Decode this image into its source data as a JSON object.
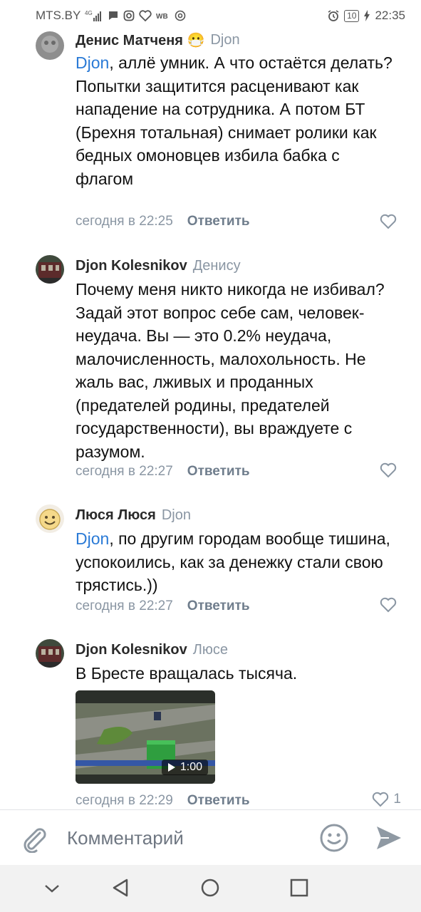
{
  "status_bar": {
    "carrier": "MTS.BY",
    "network": "4G",
    "battery": "10",
    "time": "22:35"
  },
  "comments": [
    {
      "author": "Денис Матченя",
      "author_emoji": "😷",
      "reply_to": "Djon",
      "mention": "Djon",
      "text": ", аллё умник. А что остаётся делать? Попытки защитится расценивают как нападение на сотрудника. А потом БТ (Брехня тотальная) снимает ролики как бедных омоновцев избила бабка с флагом",
      "time": "сегодня в 22:25",
      "reply_label": "Ответить",
      "likes": ""
    },
    {
      "author": "Djon Kolesnikov",
      "reply_to": "Денису",
      "mention": "",
      "text": "Почему меня никто никогда не избивал? Задай этот вопрос себе сам, человек-неудача. Вы — это 0.2% неудача, малочисленность, малохольность. Не жаль вас, лживых и проданных (предателей родины, предателей государственности), вы враждуете с разумом.",
      "time": "сегодня в 22:27",
      "reply_label": "Ответить",
      "likes": ""
    },
    {
      "author": "Люся Люся",
      "reply_to": "Djon",
      "mention": "Djon",
      "text": ", по другим городам вообще тишина, успокоились, как за денежку стали свою трястись.))",
      "time": "сегодня в 22:27",
      "reply_label": "Ответить",
      "likes": ""
    },
    {
      "author": "Djon Kolesnikov",
      "reply_to": "Люсе",
      "mention": "",
      "text": "В Бресте вращалась тысяча.",
      "video_duration": "1:00",
      "time": "сегодня в 22:29",
      "reply_label": "Ответить",
      "likes": "1"
    }
  ],
  "input": {
    "placeholder": "Комментарий"
  },
  "colors": {
    "mention": "#2a7ad6",
    "meta": "#8a96a3",
    "author": "#2a2a2a"
  }
}
